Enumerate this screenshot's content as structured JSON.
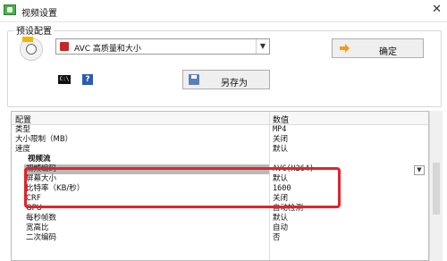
{
  "window": {
    "title": "视频设置",
    "close_symbol": "✕"
  },
  "preset": {
    "group_label": "预设配置",
    "selected_value": "AVC 高质量和大小",
    "confirm_label": "确定",
    "save_as_label": "另存为",
    "cmd_icon_text": "C:\\",
    "help_icon_text": "?"
  },
  "grid": {
    "headers": {
      "name": "配置",
      "value": "数值"
    },
    "rows": [
      {
        "name": "类型",
        "value": "MP4"
      },
      {
        "name": "大小限制（MB）",
        "value": "关闭"
      },
      {
        "name": "速度",
        "value": "默认"
      },
      {
        "name": "视频流",
        "value": ""
      },
      {
        "name": "视频编码",
        "value": "AVC(H264)"
      },
      {
        "name": "屏幕大小",
        "value": "默认"
      },
      {
        "name": "比特率（KB/秒）",
        "value": "1600"
      },
      {
        "name": "CRF",
        "value": "关闭"
      },
      {
        "name": "GPU",
        "value": "自动检测"
      },
      {
        "name": "每秒帧数",
        "value": "默认"
      },
      {
        "name": "宽高比",
        "value": "自动"
      },
      {
        "name": "二次编码",
        "value": "否"
      }
    ]
  },
  "colors": {
    "highlight": "#e3232a",
    "selected_row": "#b9b9b9"
  }
}
